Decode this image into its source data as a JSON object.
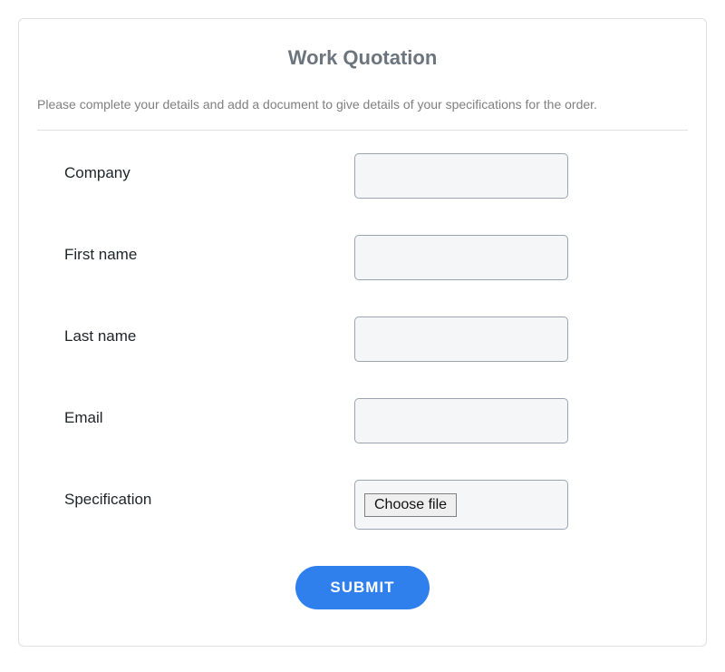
{
  "form": {
    "title": "Work Quotation",
    "description": "Please complete your details and add a document to give details of your specifications for the order.",
    "fields": {
      "company": {
        "label": "Company",
        "value": ""
      },
      "first_name": {
        "label": "First name",
        "value": ""
      },
      "last_name": {
        "label": "Last name",
        "value": ""
      },
      "email": {
        "label": "Email",
        "value": ""
      },
      "specification": {
        "label": "Specification",
        "choose_file_label": "Choose file"
      }
    },
    "submit_label": "SUBMIT"
  }
}
